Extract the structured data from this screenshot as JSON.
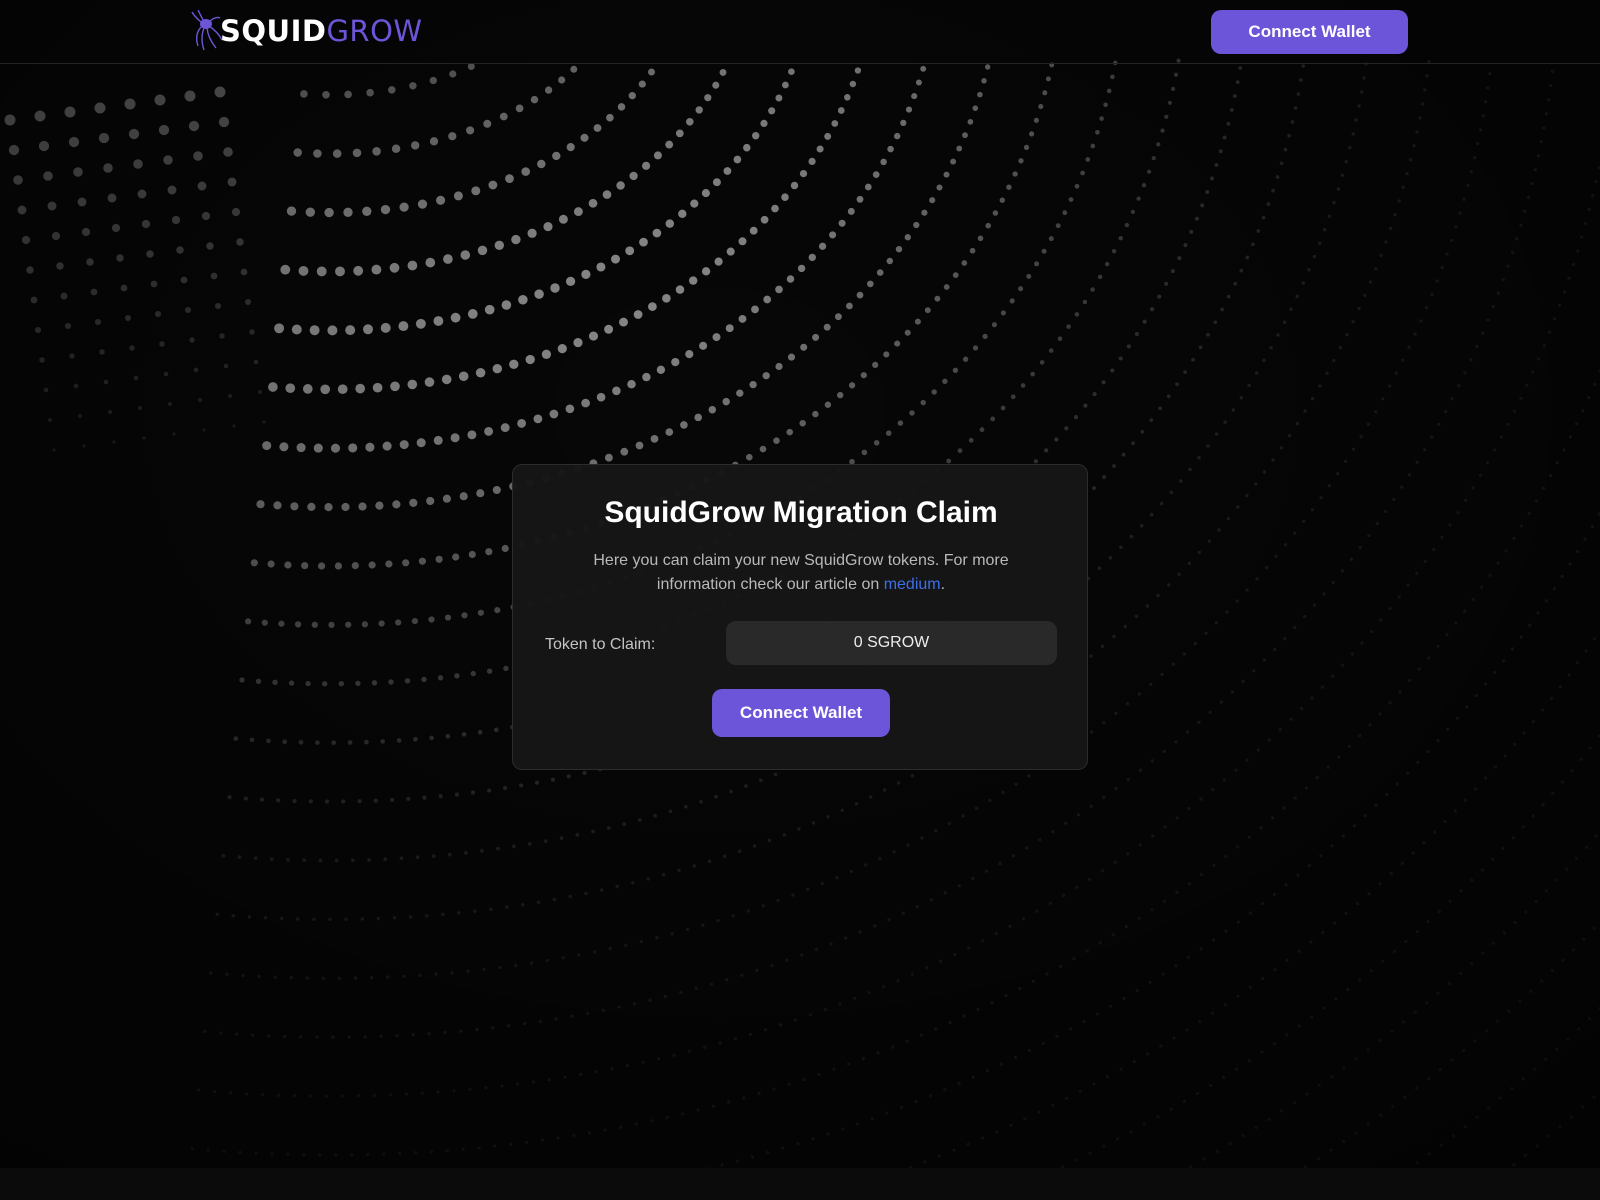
{
  "header": {
    "logo_text_primary": "SQUID",
    "logo_text_secondary": "GROW",
    "connect_button_label": "Connect Wallet"
  },
  "claim_card": {
    "title": "SquidGrow Migration Claim",
    "description_before_link": "Here you can claim your new SquidGrow tokens. For more information check our article on ",
    "link_text": "medium",
    "description_after_link": ".",
    "token_label": "Token to Claim:",
    "token_value": "0 SGROW",
    "connect_button_label": "Connect Wallet"
  },
  "colors": {
    "accent": "#6c55d8",
    "link": "#3f6ee8",
    "background": "#070707"
  },
  "icons": {
    "logo": "squid-icon"
  }
}
